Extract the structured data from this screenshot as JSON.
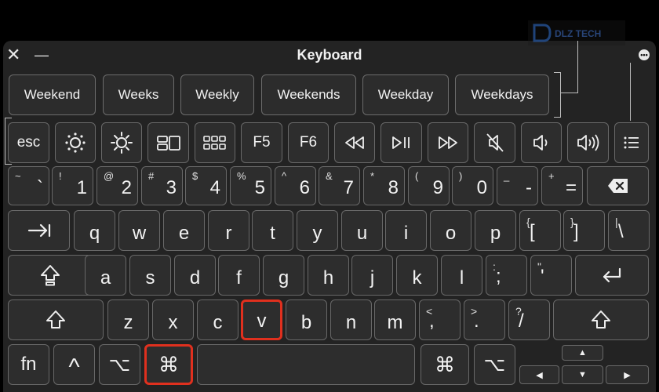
{
  "window": {
    "title": "Keyboard",
    "close_label": "✕",
    "minimize_label": "—",
    "more_label": "•••"
  },
  "watermark": {
    "text": "DLZ TECH"
  },
  "suggestions": [
    "Weekend",
    "Weeks",
    "Weekly",
    "Weekends",
    "Weekday",
    "Weekdays"
  ],
  "function_row": {
    "esc": "esc",
    "f5": "F5",
    "f6": "F6"
  },
  "number_row": [
    {
      "top": "~",
      "main": "`"
    },
    {
      "top": "!",
      "main": "1"
    },
    {
      "top": "@",
      "main": "2"
    },
    {
      "top": "#",
      "main": "3"
    },
    {
      "top": "$",
      "main": "4"
    },
    {
      "top": "%",
      "main": "5"
    },
    {
      "top": "^",
      "main": "6"
    },
    {
      "top": "&",
      "main": "7"
    },
    {
      "top": "*",
      "main": "8"
    },
    {
      "top": "(",
      "main": "9"
    },
    {
      "top": ")",
      "main": "0"
    },
    {
      "top": "_",
      "main": "-"
    },
    {
      "top": "+",
      "main": "="
    }
  ],
  "qwerty_row": [
    "q",
    "w",
    "e",
    "r",
    "t",
    "y",
    "u",
    "i",
    "o",
    "p"
  ],
  "qwerty_sym": [
    {
      "top": "{",
      "main": "["
    },
    {
      "top": "}",
      "main": "]"
    },
    {
      "top": "|",
      "main": "\\"
    }
  ],
  "home_row": [
    "a",
    "s",
    "d",
    "f",
    "g",
    "h",
    "j",
    "k",
    "l"
  ],
  "home_sym": [
    {
      "top": ":",
      "main": ";"
    },
    {
      "top": "\"",
      "main": "'"
    }
  ],
  "bottom_row": [
    "z",
    "x",
    "c",
    "v",
    "b",
    "n",
    "m"
  ],
  "bottom_sym": [
    {
      "top": "<",
      "main": ","
    },
    {
      "top": ">",
      "main": "."
    },
    {
      "top": "?",
      "main": "/"
    }
  ],
  "modifiers": {
    "fn": "fn",
    "control": "^",
    "option": "⌥",
    "command": "⌘"
  },
  "arrows": {
    "up": "▲",
    "down": "▼",
    "left": "◀",
    "right": "▶"
  },
  "highlighted_keys": [
    "v",
    "left-command"
  ],
  "colors": {
    "background": "#000000",
    "key": "#2d2d2d",
    "key_border": "#686868",
    "highlight": "#e0301e"
  }
}
